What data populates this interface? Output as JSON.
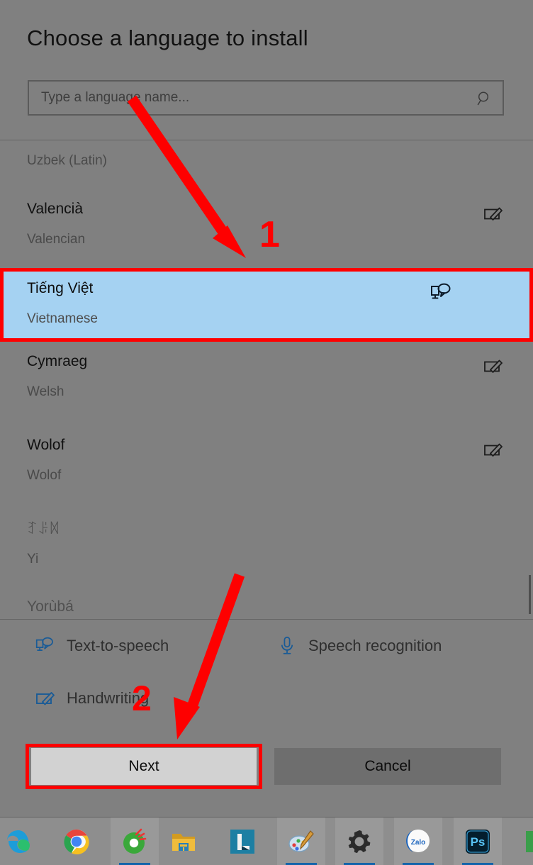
{
  "dialog": {
    "title": "Choose a language to install",
    "search": {
      "placeholder": "Type a language name...",
      "value": "",
      "icon": "search-icon"
    }
  },
  "languages": [
    {
      "native": "",
      "english": "Uzbek (Latin)",
      "icon": "",
      "selected": false,
      "partial": true
    },
    {
      "native": "Valencià",
      "english": "Valencian",
      "icon": "handwriting-icon",
      "selected": false,
      "partial": false
    },
    {
      "native": "Tiếng Việt",
      "english": "Vietnamese",
      "icon": "text-to-speech-icon",
      "selected": true,
      "partial": false
    },
    {
      "native": "Cymraeg",
      "english": "Welsh",
      "icon": "handwriting-icon",
      "selected": false,
      "partial": false
    },
    {
      "native": "Wolof",
      "english": "Wolof",
      "icon": "handwriting-icon",
      "selected": false,
      "partial": false
    },
    {
      "native": "ꆈꌠꉙ",
      "english": "Yi",
      "icon": "",
      "selected": false,
      "partial": false
    },
    {
      "native": "Yorùbá",
      "english": "",
      "icon": "",
      "selected": false,
      "partial": true
    }
  ],
  "legend": [
    {
      "label": "Text-to-speech",
      "icon": "text-to-speech-icon"
    },
    {
      "label": "Speech recognition",
      "icon": "microphone-icon"
    },
    {
      "label": "Handwriting",
      "icon": "handwriting-icon"
    }
  ],
  "buttons": {
    "next": "Next",
    "cancel": "Cancel"
  },
  "annotations": {
    "step_one": "1",
    "step_two": "2",
    "highlight_color": "#fe0000"
  },
  "taskbar": {
    "items": [
      {
        "name": "microsoft-edge",
        "label": "Microsoft Edge",
        "active": false
      },
      {
        "name": "google-chrome",
        "label": "Google Chrome",
        "active": false
      },
      {
        "name": "coc-coc",
        "label": "Coc Coc",
        "active": true
      },
      {
        "name": "file-explorer",
        "label": "File Explorer",
        "active": false
      },
      {
        "name": "l-app",
        "label": "L",
        "active": false
      },
      {
        "name": "paint",
        "label": "Paint",
        "active": true
      },
      {
        "name": "settings",
        "label": "Settings",
        "active": true
      },
      {
        "name": "zalo",
        "label": "Zalo",
        "active": true
      },
      {
        "name": "photoshop",
        "label": "Ps",
        "active": true
      }
    ]
  },
  "colors": {
    "dialog_bg": "#808080",
    "selection_blue": "#a5d2f2",
    "accent_blue": "#1a5b96",
    "annotation_red": "#fe0000",
    "next_button_bg": "#d2d2d2",
    "cancel_button_bg": "#6e6e6e"
  }
}
